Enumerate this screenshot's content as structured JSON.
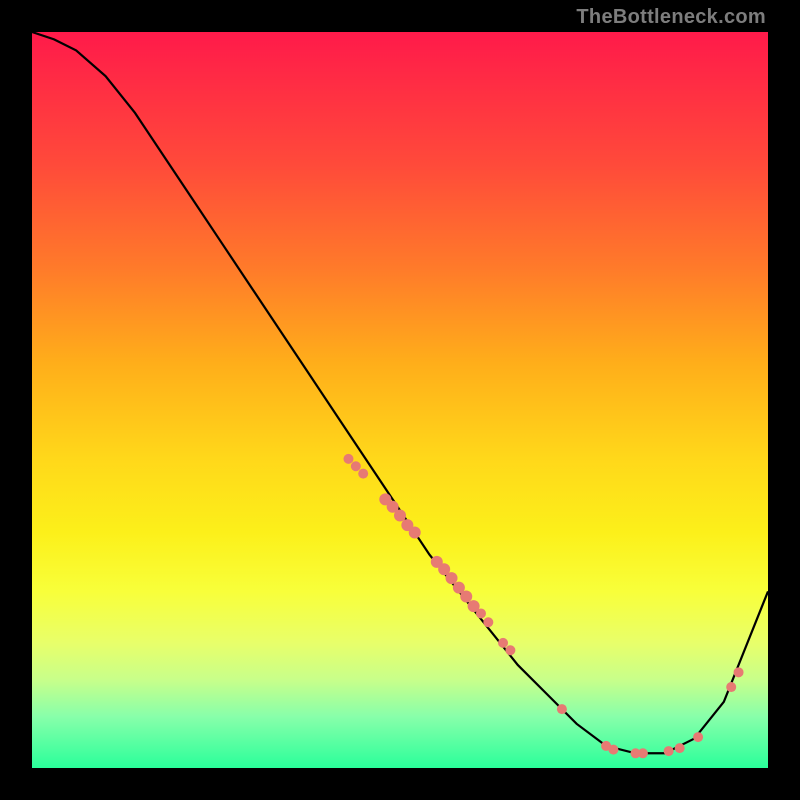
{
  "watermark": "TheBottleneck.com",
  "colors": {
    "background": "#000000",
    "gradient_top": "#ff1a4a",
    "gradient_bottom": "#2aff9a",
    "curve": "#000000",
    "markers": "#e77a73"
  },
  "chart_data": {
    "type": "line",
    "title": "",
    "xlabel": "",
    "ylabel": "",
    "xlim": [
      0,
      100
    ],
    "ylim": [
      0,
      100
    ],
    "grid": false,
    "series": [
      {
        "name": "curve",
        "x": [
          0,
          3,
          6,
          10,
          14,
          18,
          22,
          26,
          30,
          34,
          38,
          42,
          46,
          50,
          54,
          58,
          62,
          66,
          70,
          74,
          78,
          82,
          86,
          90,
          94,
          98,
          100
        ],
        "y": [
          100,
          99,
          97.5,
          94,
          89,
          83,
          77,
          71,
          65,
          59,
          53,
          47,
          41,
          35,
          29,
          24,
          19,
          14,
          10,
          6,
          3,
          2,
          2,
          4,
          9,
          19,
          24
        ]
      }
    ],
    "markers": [
      {
        "x": 43,
        "y": 42,
        "r": 5
      },
      {
        "x": 44,
        "y": 41,
        "r": 5
      },
      {
        "x": 45,
        "y": 40,
        "r": 5
      },
      {
        "x": 48,
        "y": 36.5,
        "r": 6
      },
      {
        "x": 49,
        "y": 35.5,
        "r": 6
      },
      {
        "x": 50,
        "y": 34.3,
        "r": 6
      },
      {
        "x": 51,
        "y": 33,
        "r": 6
      },
      {
        "x": 52,
        "y": 32,
        "r": 6
      },
      {
        "x": 55,
        "y": 28,
        "r": 6
      },
      {
        "x": 56,
        "y": 27,
        "r": 6
      },
      {
        "x": 57,
        "y": 25.8,
        "r": 6
      },
      {
        "x": 58,
        "y": 24.5,
        "r": 6
      },
      {
        "x": 59,
        "y": 23.3,
        "r": 6
      },
      {
        "x": 60,
        "y": 22,
        "r": 6
      },
      {
        "x": 61,
        "y": 21,
        "r": 5
      },
      {
        "x": 62,
        "y": 19.8,
        "r": 5
      },
      {
        "x": 64,
        "y": 17,
        "r": 5
      },
      {
        "x": 65,
        "y": 16,
        "r": 5
      },
      {
        "x": 72,
        "y": 8,
        "r": 5
      },
      {
        "x": 78,
        "y": 3,
        "r": 5
      },
      {
        "x": 79,
        "y": 2.5,
        "r": 5
      },
      {
        "x": 82,
        "y": 2,
        "r": 5
      },
      {
        "x": 83,
        "y": 2,
        "r": 5
      },
      {
        "x": 86.5,
        "y": 2.3,
        "r": 5
      },
      {
        "x": 88,
        "y": 2.7,
        "r": 5
      },
      {
        "x": 90.5,
        "y": 4.2,
        "r": 5
      },
      {
        "x": 95,
        "y": 11,
        "r": 5
      },
      {
        "x": 96,
        "y": 13,
        "r": 5
      }
    ]
  }
}
